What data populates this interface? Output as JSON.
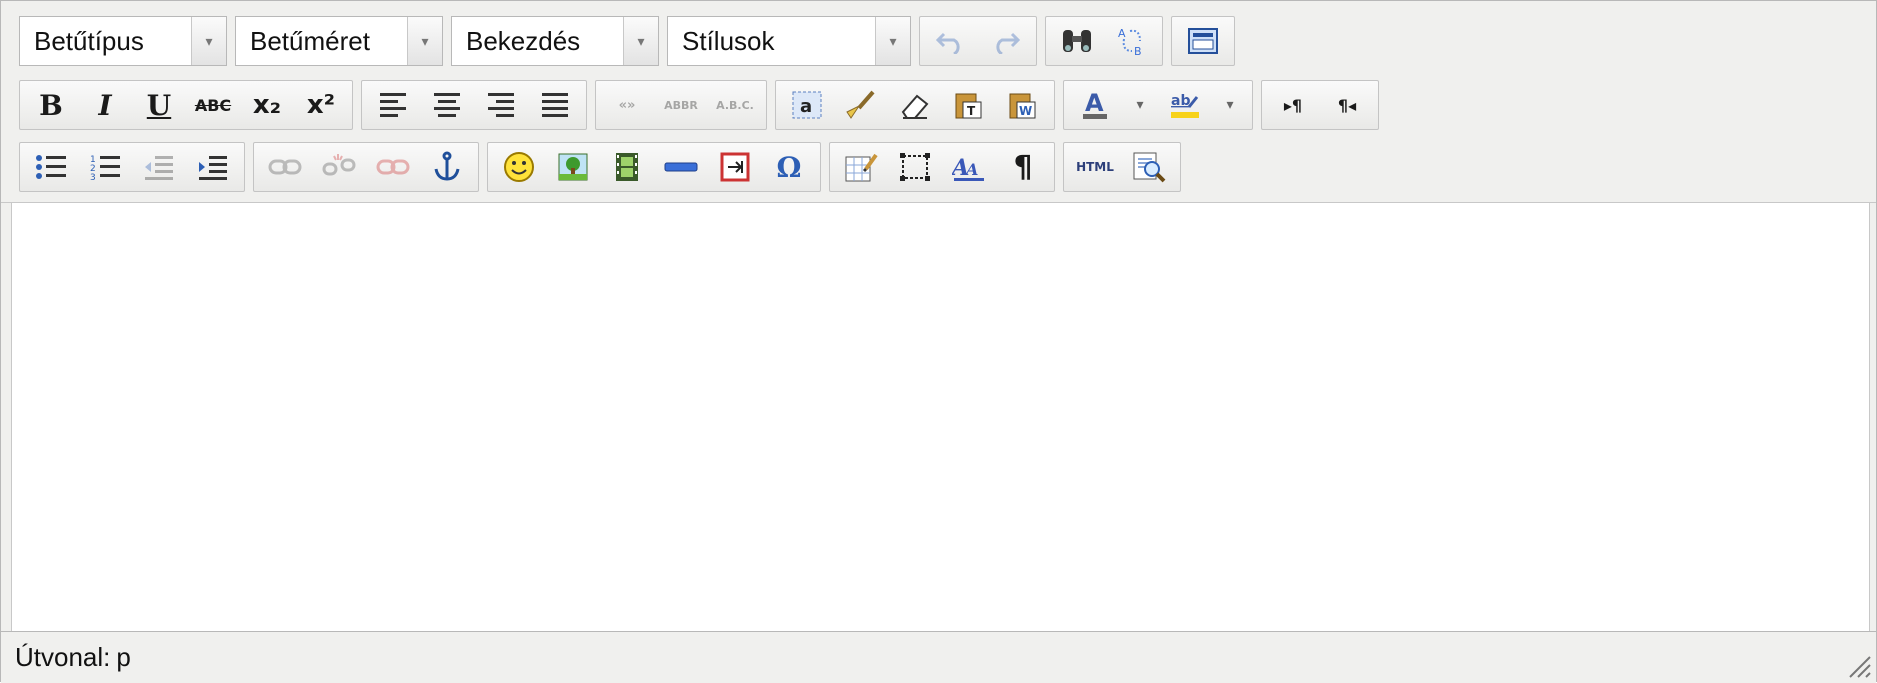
{
  "toolbar": {
    "font_family": {
      "label": "Betűtípus"
    },
    "font_size": {
      "label": "Betűméret"
    },
    "paragraph": {
      "label": "Bekezdés"
    },
    "styles": {
      "label": "Stílusok"
    },
    "dropdown_arrow": "▾",
    "bold": "B",
    "italic": "I",
    "underline": "U",
    "strikethrough": "ABC",
    "subscript": "x₂",
    "superscript": "x²",
    "cite": "«»",
    "abbr": "ABBR",
    "acronym": "A.B.C.",
    "html_source": "HTML",
    "pilcrow": "¶",
    "ltr": "▸¶",
    "rtl": "¶◂",
    "omega": "Ω",
    "colors": {
      "text_color": "#3b5ba9",
      "highlight_color": "#f7d21a",
      "accent": "#3a6fd8"
    }
  },
  "statusbar": {
    "path_label": "Útvonal:",
    "path_value": "p"
  }
}
